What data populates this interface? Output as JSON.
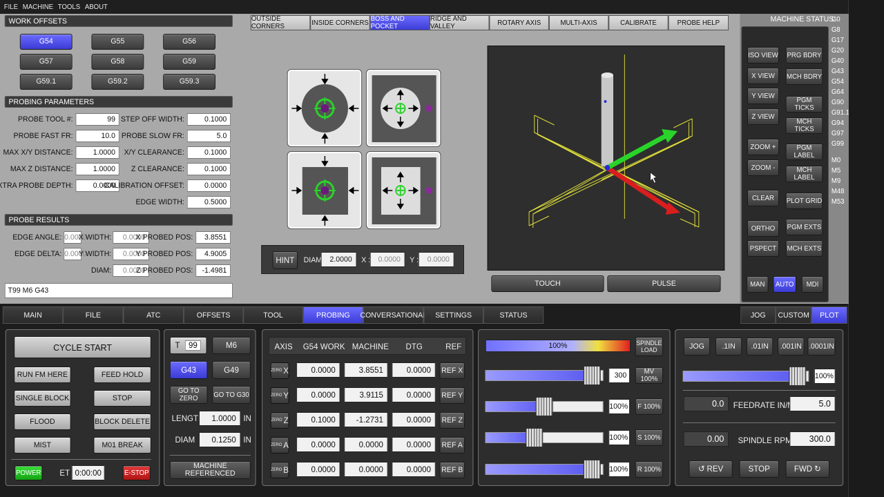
{
  "menu": {
    "items": [
      "FILE",
      "MACHINE",
      "TOOLS",
      "ABOUT"
    ]
  },
  "work_offsets": {
    "title": "WORK OFFSETS",
    "buttons": [
      "G54",
      "G55",
      "G56",
      "G57",
      "G58",
      "G59",
      "G59.1",
      "G59.2",
      "G59.3"
    ],
    "active": "G54"
  },
  "probing_params": {
    "title": "PROBING PARAMETERS",
    "left": [
      {
        "label": "PROBE TOOL #:",
        "value": "99"
      },
      {
        "label": "PROBE FAST FR:",
        "value": "10.0"
      },
      {
        "label": "MAX X/Y DISTANCE:",
        "value": "1.0000"
      },
      {
        "label": "MAX Z DISTANCE:",
        "value": "1.0000"
      },
      {
        "label": "EXTRA PROBE DEPTH:",
        "value": "0.0000"
      }
    ],
    "right": [
      {
        "label": "STEP OFF WIDTH:",
        "value": "0.1000"
      },
      {
        "label": "PROBE SLOW FR:",
        "value": "5.0"
      },
      {
        "label": "X/Y CLEARANCE:",
        "value": "0.1000"
      },
      {
        "label": "Z CLEARANCE:",
        "value": "0.1000"
      },
      {
        "label": "CALIBRATION OFFSET:",
        "value": "0.0000"
      },
      {
        "label": "EDGE WIDTH:",
        "value": "0.5000"
      }
    ]
  },
  "probe_results": {
    "title": "PROBE RESULTS",
    "col1": [
      {
        "label": "EDGE ANGLE:",
        "value": "0.0000"
      },
      {
        "label": "EDGE DELTA:",
        "value": "0.0000"
      }
    ],
    "col2": [
      {
        "label": "X WIDTH:",
        "value": "0.0000"
      },
      {
        "label": "Y WIDTH:",
        "value": "0.0000"
      },
      {
        "label": "DIAM:",
        "value": "0.0000"
      }
    ],
    "col3": [
      {
        "label": "X PROBED POS:",
        "value": "3.8551"
      },
      {
        "label": "Y PROBED POS:",
        "value": "4.9005"
      },
      {
        "label": "Z PROBED POS:",
        "value": "-1.4981"
      }
    ]
  },
  "mdi_line": "T99 M6 G43",
  "probe_tabs": {
    "items": [
      "OUTSIDE CORNERS",
      "INSIDE CORNERS",
      "BOSS AND POCKET",
      "RIDGE AND VALLEY",
      "ROTARY AXIS",
      "MULTI-AXIS",
      "CALIBRATE",
      "PROBE HELP"
    ],
    "active": "BOSS AND POCKET"
  },
  "hint": {
    "button": "HINT",
    "diam_label": "DIAM:",
    "diam": "2.0000",
    "x_label": "X :",
    "x": "0.0000",
    "y_label": "Y :",
    "y": "0.0000"
  },
  "touch": "TOUCH",
  "pulse": "PULSE",
  "machine_status": {
    "title": "MACHINE STATUS:",
    "codes": [
      "G0",
      "G8",
      "G17",
      "G20",
      "G40",
      "G43",
      "G54",
      "G64",
      "G90",
      "G91.1",
      "G94",
      "G97",
      "G99",
      "",
      "M0",
      "M5",
      "M9",
      "M48",
      "M53"
    ]
  },
  "view_buttons": {
    "left": [
      "ISO VIEW",
      "X VIEW",
      "Y VIEW",
      "Z VIEW",
      "ZOOM +",
      "ZOOM -",
      "CLEAR",
      "ORTHO",
      "PSPECT"
    ],
    "right": [
      "PRG BDRY",
      "MCH BDRY",
      "PGM TICKS",
      "MCH TICKS",
      "PGM LABEL",
      "MCH LABEL",
      "PLOT GRID",
      "PGM EXTS",
      "MCH EXTS"
    ]
  },
  "mode_buttons": {
    "items": [
      "MAN",
      "AUTO",
      "MDI"
    ],
    "active": "AUTO"
  },
  "main_tabs": {
    "items": [
      "MAIN",
      "FILE",
      "ATC",
      "OFFSETS",
      "TOOL",
      "PROBING",
      "CONVERSATIONAL",
      "SETTINGS",
      "STATUS"
    ],
    "active": "PROBING"
  },
  "right_tabs": {
    "items": [
      "JOG",
      "CUSTOM",
      "PLOT"
    ],
    "active": "PLOT"
  },
  "cycle": {
    "start": "CYCLE START",
    "run_from_here": "RUN FM HERE",
    "feed_hold": "FEED HOLD",
    "single_block": "SINGLE BLOCK",
    "stop": "STOP",
    "flood": "FLOOD",
    "block_delete": "BLOCK DELETE",
    "mist": "MIST",
    "m01_break": "M01 BREAK",
    "power": "POWER",
    "et_label": "ET",
    "et_value": "0:00:00",
    "estop": "E-STOP"
  },
  "tool": {
    "t_label": "T",
    "t_value": "99",
    "m6": "M6",
    "g43": "G43",
    "g49": "G49",
    "go_to_zero": "GO TO ZERO",
    "go_to_g30": "GO TO G30",
    "length_label": "LENGTH",
    "length": "1.0000",
    "diam_label": "DIAM",
    "diam": "0.1250",
    "unit": "IN",
    "machine_referenced": "MACHINE REFERENCED"
  },
  "dro": {
    "headers": [
      "AXIS",
      "G54 WORK",
      "MACHINE",
      "DTG",
      "REF"
    ],
    "zero_label": "ZERO",
    "rows": [
      {
        "axis": "X",
        "work": "0.0000",
        "machine": "3.8551",
        "dtg": "0.0000",
        "ref": "REF X"
      },
      {
        "axis": "Y",
        "work": "0.0000",
        "machine": "3.9115",
        "dtg": "0.0000",
        "ref": "REF Y"
      },
      {
        "axis": "Z",
        "work": "0.1000",
        "machine": "-1.2731",
        "dtg": "0.0000",
        "ref": "REF Z"
      },
      {
        "axis": "A",
        "work": "0.0000",
        "machine": "0.0000",
        "dtg": "0.0000",
        "ref": "REF A"
      },
      {
        "axis": "B",
        "work": "0.0000",
        "machine": "0.0000",
        "dtg": "0.0000",
        "ref": "REF B"
      }
    ]
  },
  "overrides": {
    "spindle_load_pct": "100%",
    "spindle_load_label": "SPINDLE LOAD",
    "rows": [
      {
        "value": "300",
        "button": "MV 100%",
        "level": 0.98
      },
      {
        "value": "100%",
        "button": "F 100%",
        "level": 0.5
      },
      {
        "value": "100%",
        "button": "S 100%",
        "level": 0.4
      },
      {
        "value": "100%",
        "button": "R 100%",
        "level": 0.98
      }
    ]
  },
  "jog": {
    "buttons": [
      "JOG",
      ".1IN",
      ".01IN",
      ".001IN",
      ".0001IN"
    ],
    "slider_value": "100%",
    "slider_level": 0.98,
    "feed_actual": "0.0",
    "feed_label": "FEEDRATE IN/M",
    "feed_set": "5.0",
    "spindle_actual": "0.00",
    "spindle_label": "SPINDLE RPM",
    "spindle_set": "300.0",
    "rev": "REV",
    "stop": "STOP",
    "fwd": "FWD"
  }
}
